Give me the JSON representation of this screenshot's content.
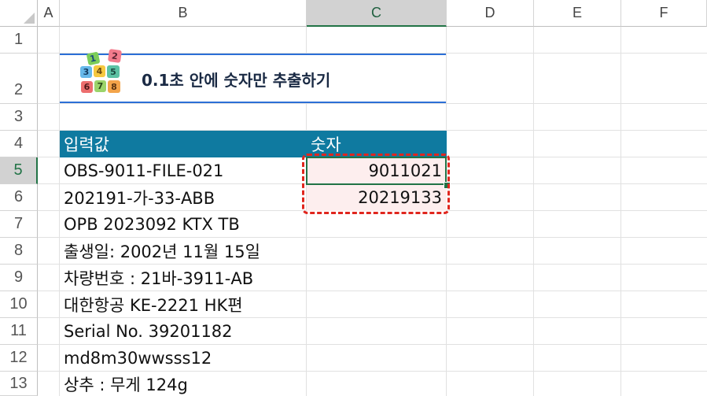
{
  "columns": [
    "A",
    "B",
    "C",
    "D",
    "E",
    "F"
  ],
  "rows": [
    "1",
    "2",
    "3",
    "4",
    "5",
    "6",
    "7",
    "8",
    "9",
    "10",
    "11",
    "12",
    "13"
  ],
  "selected_column": "C",
  "selected_row": "5",
  "title": "0.1초 안에 숫자만 추출하기",
  "logo_digits": [
    "1",
    "2",
    "3",
    "4",
    "5",
    "6",
    "7",
    "8"
  ],
  "table": {
    "header_input": "입력값",
    "header_number": "숫자",
    "inputs": [
      "OBS-9011-FILE-021",
      "202191-가-33-ABB",
      "OPB 2023092 KTX TB",
      "출생일: 2002년 11월 15일",
      "차량번호 : 21바-3911-AB",
      "대한항공 KE-2221 HK편",
      "Serial No. 39201182",
      "md8m30wwsss12",
      "상추 : 무게 124g"
    ],
    "numbers": [
      "9011021",
      "20219133"
    ]
  },
  "colors": {
    "header_fill": "#0f7aa0",
    "highlight_fill": "#fdeeee",
    "dashed_border": "#e0261e",
    "selection": "#217346",
    "title_rule": "#2b6fd6"
  }
}
